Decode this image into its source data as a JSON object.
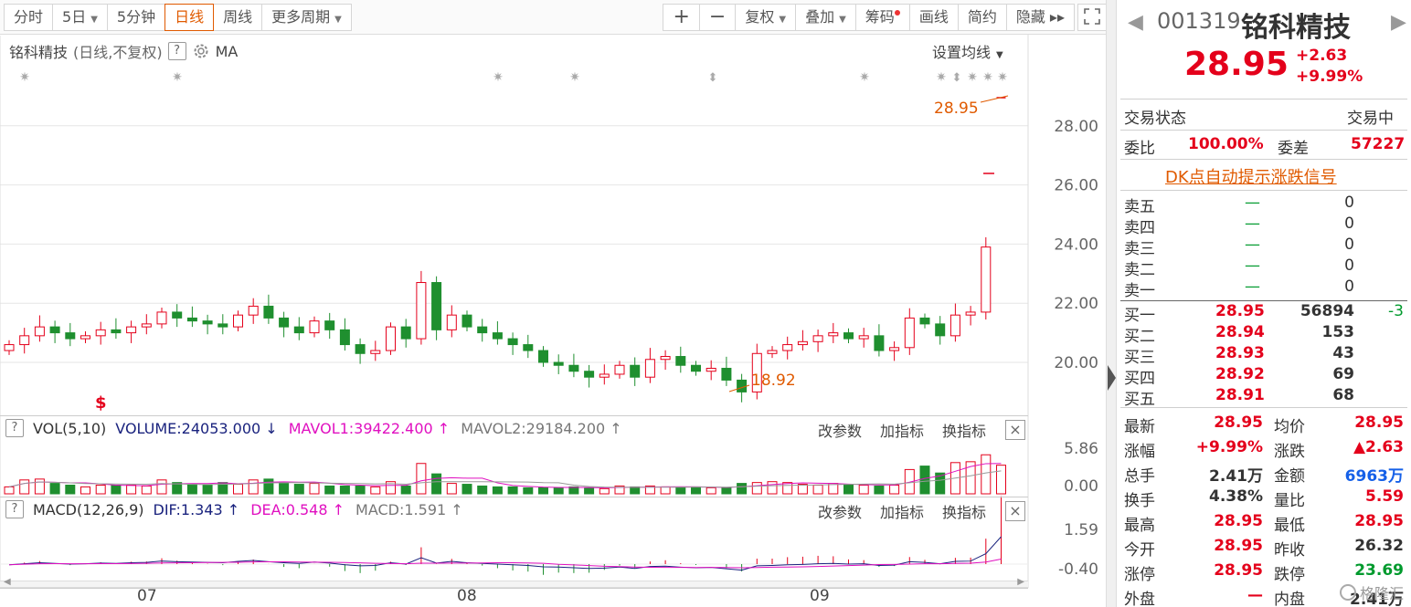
{
  "toolbar": {
    "periods": [
      {
        "label": "分时"
      },
      {
        "label": "5日",
        "dd": true
      },
      {
        "label": "5分钟"
      },
      {
        "label": "日线",
        "active": true
      },
      {
        "label": "周线"
      },
      {
        "label": "更多周期",
        "dd": true
      }
    ],
    "tools": [
      {
        "label": "+"
      },
      {
        "label": "−"
      },
      {
        "label": "复权",
        "dd": true
      },
      {
        "label": "叠加",
        "dd": true
      },
      {
        "label": "筹码",
        "dot": true
      },
      {
        "label": "画线"
      },
      {
        "label": "简约"
      },
      {
        "label": "隐藏 ▸▸"
      }
    ],
    "fullscreen_icon": "expand-icon"
  },
  "kline": {
    "title": "铭科精技",
    "mode": "(日线,不复权)",
    "indicator": "MA",
    "settings_label": "设置均线",
    "y_ticks": [
      "28.00",
      "26.00",
      "24.00",
      "22.00",
      "20.00"
    ],
    "high_label": "28.95",
    "low_label": "18.92",
    "signal_mark": "$"
  },
  "vol": {
    "name": "VOL(5,10)",
    "volume": "VOLUME:24053.000",
    "mavol1": "MAVOL1:39422.400",
    "mavol2": "MAVOL2:29184.200",
    "y_ticks": [
      "5.86",
      "0.00"
    ],
    "buttons": [
      "改参数",
      "加指标",
      "换指标"
    ]
  },
  "macd": {
    "name": "MACD(12,26,9)",
    "dif": "DIF:1.343",
    "dea": "DEA:0.548",
    "macd": "MACD:1.591",
    "y_ticks": [
      "1.59",
      "-0.40"
    ],
    "buttons": [
      "改参数",
      "加指标",
      "换指标"
    ]
  },
  "x_axis": [
    "07",
    "08",
    "09"
  ],
  "quote": {
    "code": "001319",
    "name": "铭科精技",
    "price": "28.95",
    "change": "+2.63",
    "change_pct": "+9.99%",
    "status_label": "交易状态",
    "status_value": "交易中",
    "weibi_label": "委比",
    "weibi_value": "100.00%",
    "weicha_label": "委差",
    "weicha_value": "57227",
    "dk_link": "DK点自动提示涨跌信号"
  },
  "asks": [
    {
      "label": "卖五",
      "price": "—",
      "vol": "0"
    },
    {
      "label": "卖四",
      "price": "—",
      "vol": "0"
    },
    {
      "label": "卖三",
      "price": "—",
      "vol": "0"
    },
    {
      "label": "卖二",
      "price": "—",
      "vol": "0"
    },
    {
      "label": "卖一",
      "price": "—",
      "vol": "0"
    }
  ],
  "bids": [
    {
      "label": "买一",
      "price": "28.95",
      "vol": "56894",
      "delta": "-3"
    },
    {
      "label": "买二",
      "price": "28.94",
      "vol": "153",
      "delta": ""
    },
    {
      "label": "买三",
      "price": "28.93",
      "vol": "43",
      "delta": ""
    },
    {
      "label": "买四",
      "price": "28.92",
      "vol": "69",
      "delta": ""
    },
    {
      "label": "买五",
      "price": "28.91",
      "vol": "68",
      "delta": ""
    }
  ],
  "stats": [
    {
      "l1": "最新",
      "v1": "28.95",
      "c1": "red",
      "l2": "均价",
      "v2": "28.95",
      "c2": "red"
    },
    {
      "l1": "涨幅",
      "v1": "+9.99%",
      "c1": "red",
      "l2": "涨跌",
      "v2": "▲2.63",
      "c2": "red"
    },
    {
      "l1": "总手",
      "v1": "2.41万",
      "c1": "dark",
      "l2": "金额",
      "v2": "6963万",
      "c2": "blue"
    },
    {
      "l1": "换手",
      "v1": "4.38%",
      "c1": "dark",
      "l2": "量比",
      "v2": "5.59",
      "c2": "red"
    },
    {
      "l1": "最高",
      "v1": "28.95",
      "c1": "red",
      "l2": "最低",
      "v2": "28.95",
      "c2": "red"
    },
    {
      "l1": "今开",
      "v1": "28.95",
      "c1": "red",
      "l2": "昨收",
      "v2": "26.32",
      "c2": "dark"
    },
    {
      "l1": "涨停",
      "v1": "28.95",
      "c1": "red",
      "l2": "跌停",
      "v2": "23.69",
      "c2": "green"
    },
    {
      "l1": "外盘",
      "v1": "—",
      "c1": "red",
      "l2": "内盘",
      "v2": "2.41万",
      "c2": "dark"
    }
  ],
  "watermark": "格隆汇",
  "colors": {
    "up": "#e4001b",
    "down": "#1f8f2f",
    "accent": "#e05a00"
  }
}
